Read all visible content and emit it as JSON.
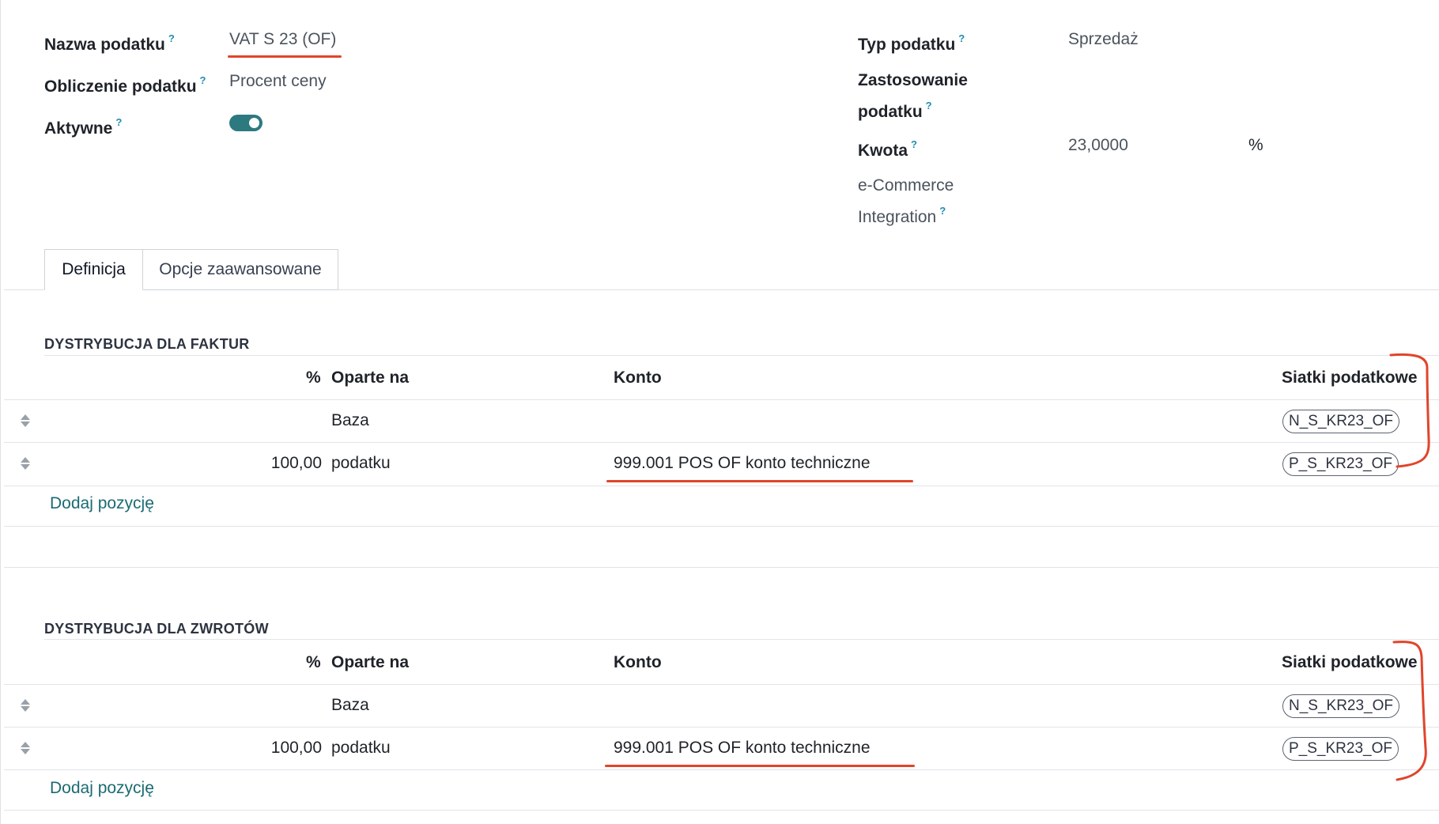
{
  "form": {
    "tax_name_label": "Nazwa podatku",
    "tax_name_value": "VAT S 23 (OF)",
    "tax_calc_label": "Obliczenie podatku",
    "tax_calc_value": "Procent ceny",
    "active_label": "Aktywne",
    "active_value": true,
    "tax_type_label": "Typ podatku",
    "tax_type_value": "Sprzedaż",
    "tax_scope_label_1": "Zastosowanie",
    "tax_scope_label_2": "podatku",
    "amount_label": "Kwota",
    "amount_value": "23,0000",
    "amount_unit": "%",
    "ecommerce_label_1": "e-Commerce",
    "ecommerce_label_2": "Integration",
    "help_mark": "?"
  },
  "tabs": [
    {
      "label": "Definicja",
      "active": true
    },
    {
      "label": "Opcje zaawansowane",
      "active": false
    }
  ],
  "invoice_section": {
    "title": "DYSTRYBUCJA DLA FAKTUR",
    "columns": {
      "percent": "%",
      "based_on": "Oparte na",
      "account": "Konto",
      "tax_grids": "Siatki podatkowe"
    },
    "rows": [
      {
        "percent": "",
        "based_on": "Baza",
        "account": "",
        "tax_grid": "N_S_KR23_OF"
      },
      {
        "percent": "100,00",
        "based_on": "podatku",
        "account": "999.001 POS OF konto techniczne",
        "tax_grid": "P_S_KR23_OF"
      }
    ],
    "add_line": "Dodaj pozycję"
  },
  "refund_section": {
    "title": "DYSTRYBUCJA DLA ZWROTÓW",
    "columns": {
      "percent": "%",
      "based_on": "Oparte na",
      "account": "Konto",
      "tax_grids": "Siatki podatkowe"
    },
    "rows": [
      {
        "percent": "",
        "based_on": "Baza",
        "account": "",
        "tax_grid": "N_S_KR23_OF"
      },
      {
        "percent": "100,00",
        "based_on": "podatku",
        "account": "999.001 POS OF konto techniczne",
        "tax_grid": "P_S_KR23_OF"
      }
    ],
    "add_line": "Dodaj pozycję"
  },
  "colors": {
    "accent": "#2c7a80",
    "link": "#1b6b73",
    "help": "#1f8fae",
    "annotation": "#e0452b"
  }
}
